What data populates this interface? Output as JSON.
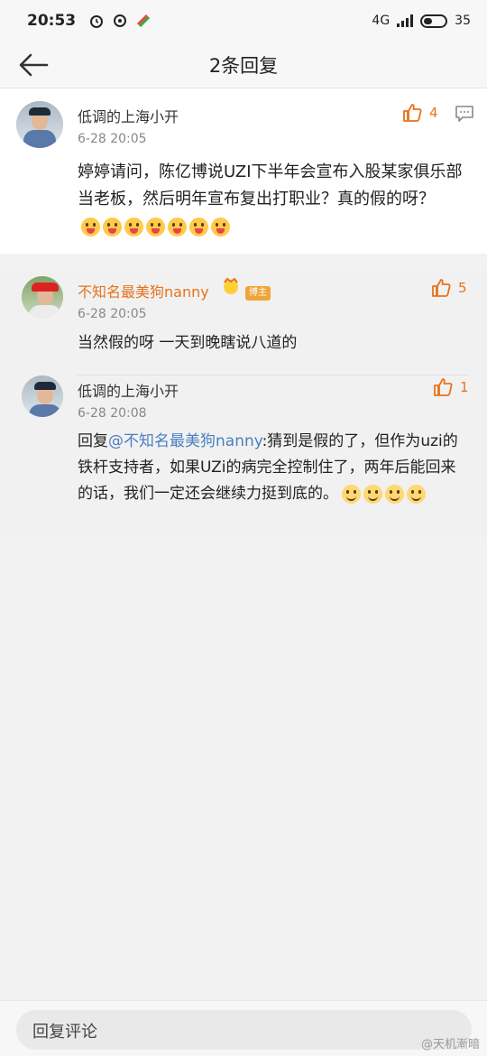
{
  "status_bar": {
    "time": "20:53",
    "network": "4G",
    "battery": "35"
  },
  "header": {
    "title": "2条回复",
    "back_icon": "arrow-left-icon"
  },
  "main_comment": {
    "user": "低调的上海小开",
    "time": "6-28 20:05",
    "likes": "4",
    "text": "婷婷请问，陈亿博说UZI下半年会宣布入股某家俱乐部当老板，然后明年宣布复出打职业？真的假的呀？",
    "emoji_count": 7
  },
  "replies": [
    {
      "user": "不知名最美狗nanny",
      "badge": "博主",
      "time": "6-28 20:05",
      "likes": "5",
      "text": "当然假的呀 一天到晚瞎说八道的"
    },
    {
      "user": "低调的上海小开",
      "time": "6-28 20:08",
      "likes": "1",
      "reply_prefix": "回复",
      "mention": "@不知名最美狗nanny",
      "text_line1": ":猜到是假的了，但作为",
      "text_rest": "uzi的铁杆支持者，如果UZi的病完全控制住了，两年后能回来的话，我们一定还会继续力挺到底的。"
    }
  ],
  "bottom_bar": {
    "placeholder": "回复评论"
  },
  "watermark": "@天机漸暗",
  "colors": {
    "accent": "#e8721c",
    "mention": "#4a7fc1"
  }
}
